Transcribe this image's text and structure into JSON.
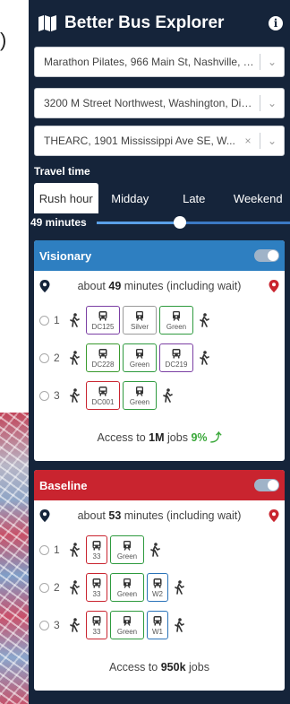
{
  "app": {
    "title": "Better Bus Explorer"
  },
  "background_map": {
    "label": ")"
  },
  "search": {
    "home_location": "Marathon Pilates, 966 Main St, Nashville, Te...",
    "origin": "3200 M Street Northwest, Washington, Dist...",
    "destination": "THEARC, 1901 Mississippi Ave SE, W...",
    "clear_symbol": "×",
    "dropdown_symbol": "⌄"
  },
  "travel_time": {
    "label": "Travel time",
    "tabs": [
      {
        "label": "Rush hour",
        "active": true
      },
      {
        "label": "Midday",
        "active": false
      },
      {
        "label": "Late",
        "active": false
      },
      {
        "label": "Weekend",
        "active": false
      }
    ],
    "slider_value_label": "49 minutes",
    "slider_fraction": 0.43
  },
  "scenarios": [
    {
      "title": "Visionary",
      "header_color": "#2e7fc1",
      "summary_prefix": "about",
      "minutes": "49",
      "summary_suffix": "minutes (including wait)",
      "routes": [
        {
          "num": "1",
          "legs": [
            {
              "name": "DC125",
              "color": "#7b3fa3"
            },
            {
              "name": "Silver",
              "color": "#9a9a9a"
            },
            {
              "name": "Green",
              "color": "#2e9a3e"
            }
          ]
        },
        {
          "num": "2",
          "legs": [
            {
              "name": "DC228",
              "color": "#3a9a2e"
            },
            {
              "name": "Green",
              "color": "#2e9a3e"
            },
            {
              "name": "DC219",
              "color": "#7b3fa3"
            }
          ]
        },
        {
          "num": "3",
          "legs": [
            {
              "name": "DC001",
              "color": "#c9242f"
            },
            {
              "name": "Green",
              "color": "#2e9a3e"
            }
          ]
        }
      ],
      "access_prefix": "Access to",
      "access_value": "1M",
      "access_suffix": "jobs",
      "access_change": "9%",
      "access_change_arrow": "⤴"
    },
    {
      "title": "Baseline",
      "header_color": "#c9242f",
      "summary_prefix": "about",
      "minutes": "53",
      "summary_suffix": "minutes (including wait)",
      "routes": [
        {
          "num": "1",
          "legs": [
            {
              "name": "33",
              "color": "#c9242f"
            },
            {
              "name": "Green",
              "color": "#2e9a3e"
            }
          ]
        },
        {
          "num": "2",
          "legs": [
            {
              "name": "33",
              "color": "#c9242f"
            },
            {
              "name": "Green",
              "color": "#2e9a3e"
            },
            {
              "name": "W2",
              "color": "#2a73b8"
            }
          ]
        },
        {
          "num": "3",
          "legs": [
            {
              "name": "33",
              "color": "#c9242f"
            },
            {
              "name": "Green",
              "color": "#2e9a3e"
            },
            {
              "name": "W1",
              "color": "#2a73b8"
            }
          ]
        }
      ],
      "access_prefix": "Access to",
      "access_value": "950k",
      "access_suffix": "jobs"
    }
  ],
  "colors": {
    "panel_bg": "#15243a",
    "origin_pin": "#15243a",
    "destination_pin": "#c9242f",
    "positive_change": "#3aa83a"
  },
  "icons": {
    "brand": "map-icon",
    "info": "info-icon",
    "walk": "walk-icon",
    "bus": "bus-icon",
    "rail": "rail-icon",
    "origin": "origin-pin-icon",
    "destination": "destination-pin-icon"
  }
}
